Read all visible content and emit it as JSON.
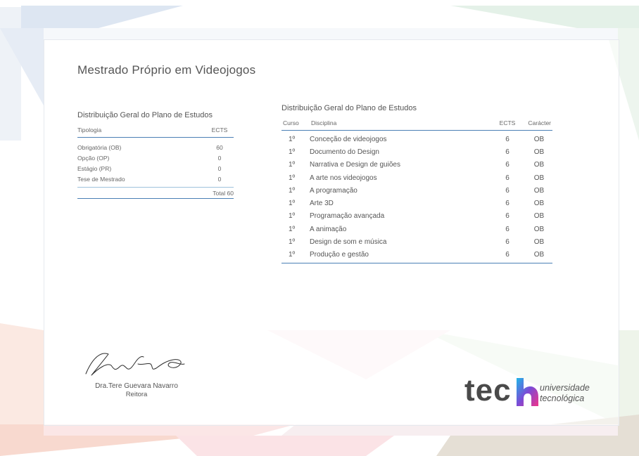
{
  "document": {
    "title": "Mestrado Próprio em Videojogos"
  },
  "summary_table": {
    "title": "Distribuição Geral do Plano de Estudos",
    "headers": {
      "type": "Tipologia",
      "ects": "ECTS"
    },
    "rows": [
      {
        "type": "Obrigatória (OB)",
        "ects": "60"
      },
      {
        "type": "Opção (OP)",
        "ects": "0"
      },
      {
        "type": "Estágio (PR)",
        "ects": "0"
      },
      {
        "type": "Tese de Mestrado",
        "ects": "0"
      }
    ],
    "total": "Total 60"
  },
  "detail_table": {
    "title": "Distribuição Geral do Plano de Estudos",
    "headers": {
      "course": "Curso",
      "subject": "Disciplina",
      "ects": "ECTS",
      "character": "Carácter"
    },
    "rows": [
      {
        "course": "1º",
        "subject": "Conceção de videojogos",
        "ects": "6",
        "character": "OB"
      },
      {
        "course": "1º",
        "subject": "Documento do Design",
        "ects": "6",
        "character": "OB"
      },
      {
        "course": "1º",
        "subject": "Narrativa e Design de guiões",
        "ects": "6",
        "character": "OB"
      },
      {
        "course": "1º",
        "subject": "A arte nos videojogos",
        "ects": "6",
        "character": "OB"
      },
      {
        "course": "1º",
        "subject": "A programação",
        "ects": "6",
        "character": "OB"
      },
      {
        "course": "1º",
        "subject": "Arte 3D",
        "ects": "6",
        "character": "OB"
      },
      {
        "course": "1º",
        "subject": "Programação avançada",
        "ects": "6",
        "character": "OB"
      },
      {
        "course": "1º",
        "subject": "A animação",
        "ects": "6",
        "character": "OB"
      },
      {
        "course": "1º",
        "subject": "Design de som e música",
        "ects": "6",
        "character": "OB"
      },
      {
        "course": "1º",
        "subject": "Produção e gestão",
        "ects": "6",
        "character": "OB"
      }
    ]
  },
  "signature": {
    "name": "Dra.Tere Guevara Navarro",
    "role": "Reitora"
  },
  "logo": {
    "word": "tec",
    "line1": "universidade",
    "line2": "tecnológica",
    "colors": {
      "gradient_start": "#1fb6e8",
      "gradient_mid": "#7b4bd6",
      "gradient_end": "#f0348a"
    }
  },
  "theme": {
    "accent_line": "#4a7fb5",
    "light_line": "#9fc3dc"
  }
}
